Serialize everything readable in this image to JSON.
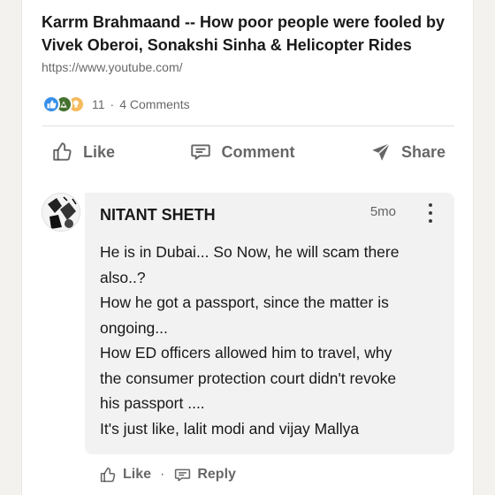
{
  "post": {
    "article_title": "Karrm Brahmaand -- How poor people were fooled by Vivek Oberoi, Sonakshi Sinha & Helicopter Rides",
    "article_url": "https://www.youtube.com/",
    "reaction_count": "11",
    "dot": "·",
    "comments_count": "4 Comments",
    "reaction_icons": [
      "like-icon",
      "celebrate-icon",
      "insightful-icon"
    ]
  },
  "actions": {
    "like_label": "Like",
    "comment_label": "Comment",
    "share_label": "Share"
  },
  "comment": {
    "author": "NITANT SHETH",
    "time": "5mo",
    "lines": [
      "He is in Dubai... So Now, he will scam there",
      "also..?",
      "How he got a passport, since the matter is",
      "ongoing...",
      "How ED officers allowed him to travel, why",
      "the consumer protection court didn't revoke",
      "his passport ....",
      "It's just like, lalit modi and vijay Mallya"
    ],
    "like_label": "Like",
    "dot": "·",
    "reply_label": "Reply"
  },
  "colors": {
    "like_blue": "#378fe9",
    "celebrate_green": "#44712e",
    "insight_yellow": "#f5bb5c",
    "bubble_bg": "#f2f2f2"
  }
}
